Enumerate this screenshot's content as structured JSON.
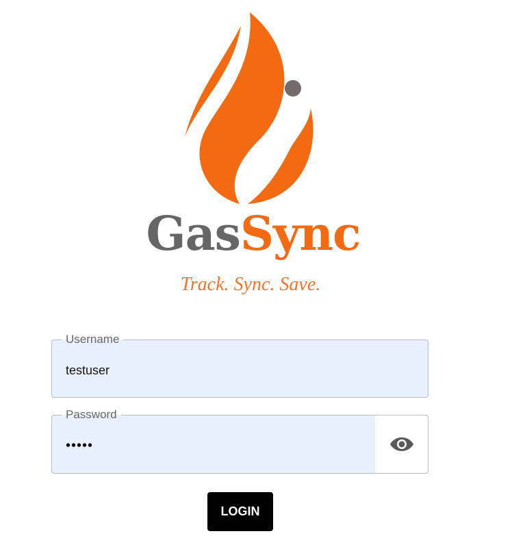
{
  "brand": {
    "name_part1": "Gas",
    "name_part2": "Sync",
    "tagline": "Track. Sync. Save.",
    "colors": {
      "primary_orange": "#f26a12",
      "gray": "#666666",
      "dot": "#736a6a"
    },
    "logo_icon": "flame-logo-icon"
  },
  "form": {
    "username": {
      "label": "Username",
      "value": "testuser"
    },
    "password": {
      "label": "Password",
      "value": "•••••",
      "toggle_icon": "eye-icon"
    },
    "login_label": "LOGIN"
  },
  "colors": {
    "field_background": "#e8f0fe",
    "button_background": "#000000"
  }
}
